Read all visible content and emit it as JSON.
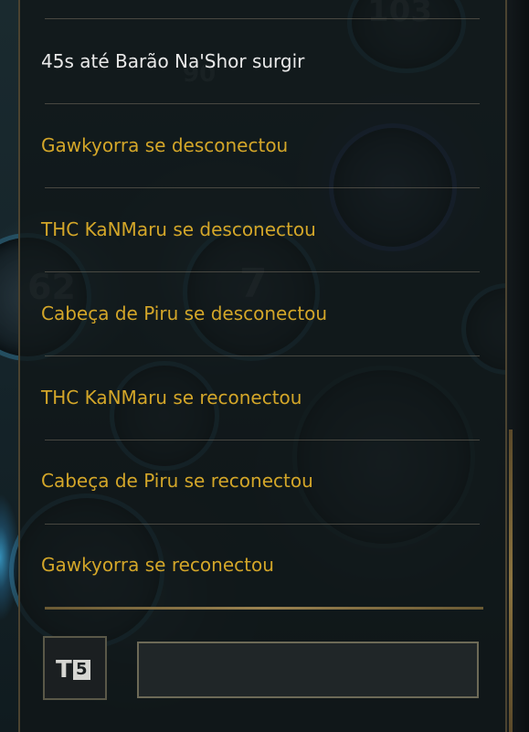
{
  "chat": {
    "messages": [
      {
        "text": "45s até Barão Na'Shor surgir",
        "kind": "system"
      },
      {
        "text": "Gawkyorra se desconectou",
        "kind": "event"
      },
      {
        "text": "THC KaNMaru se desconectou",
        "kind": "event"
      },
      {
        "text": "Cabeça de Piru se desconectou",
        "kind": "event"
      },
      {
        "text": "THC KaNMaru se reconectou",
        "kind": "event"
      },
      {
        "text": "Cabeça de Piru se reconectou",
        "kind": "event"
      },
      {
        "text": "Gawkyorra se reconectou",
        "kind": "event"
      }
    ],
    "channel_icon": {
      "name": "team-chat-channel-icon",
      "letter": "T",
      "number": "5"
    },
    "input": {
      "value": "",
      "placeholder": ""
    }
  },
  "background": {
    "numbers": [
      "103",
      "90",
      "62",
      "7"
    ]
  },
  "colors": {
    "system_text": "#e9e9e9",
    "event_text": "#d3a629",
    "panel_bg": "#101618",
    "gold_rule": "#9a8250"
  }
}
